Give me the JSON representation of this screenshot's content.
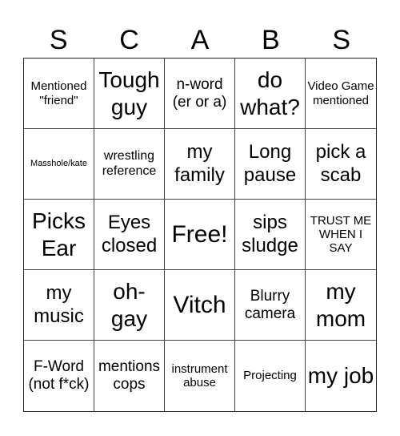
{
  "card": {
    "header_letters": [
      "S",
      "C",
      "A",
      "B",
      "S"
    ],
    "rows": [
      [
        {
          "text": "Mentioned \"friend\"",
          "size": "fs-s"
        },
        {
          "text": "Tough guy",
          "size": "fs-xl"
        },
        {
          "text": "n-word (er or a)",
          "size": "fs-m"
        },
        {
          "text": "do what?",
          "size": "fs-xl"
        },
        {
          "text": "Video Game mentioned",
          "size": "fs-s"
        }
      ],
      [
        {
          "text": "Masshole/kate",
          "size": "fs-xs"
        },
        {
          "text": "wrestling reference",
          "size": "fs-sm"
        },
        {
          "text": "my family",
          "size": "fs-l"
        },
        {
          "text": "Long pause",
          "size": "fs-l"
        },
        {
          "text": "pick a scab",
          "size": "fs-l"
        }
      ],
      [
        {
          "text": "Picks Ear",
          "size": "fs-xl"
        },
        {
          "text": "Eyes closed",
          "size": "fs-l"
        },
        {
          "text": "Free!",
          "size": "fs-xxl"
        },
        {
          "text": "sips sludge",
          "size": "fs-l"
        },
        {
          "text": "TRUST ME WHEN I SAY",
          "size": "fs-s"
        }
      ],
      [
        {
          "text": "my music",
          "size": "fs-l"
        },
        {
          "text": "oh-gay",
          "size": "fs-xl"
        },
        {
          "text": "Vitch",
          "size": "fs-xxl"
        },
        {
          "text": "Blurry camera",
          "size": "fs-m"
        },
        {
          "text": "my mom",
          "size": "fs-xl"
        }
      ],
      [
        {
          "text": "F-Word (not f*ck)",
          "size": "fs-m"
        },
        {
          "text": "mentions cops",
          "size": "fs-m"
        },
        {
          "text": "instrument abuse",
          "size": "fs-s"
        },
        {
          "text": "Projecting",
          "size": "fs-s"
        },
        {
          "text": "my job",
          "size": "fs-xl"
        }
      ]
    ]
  }
}
